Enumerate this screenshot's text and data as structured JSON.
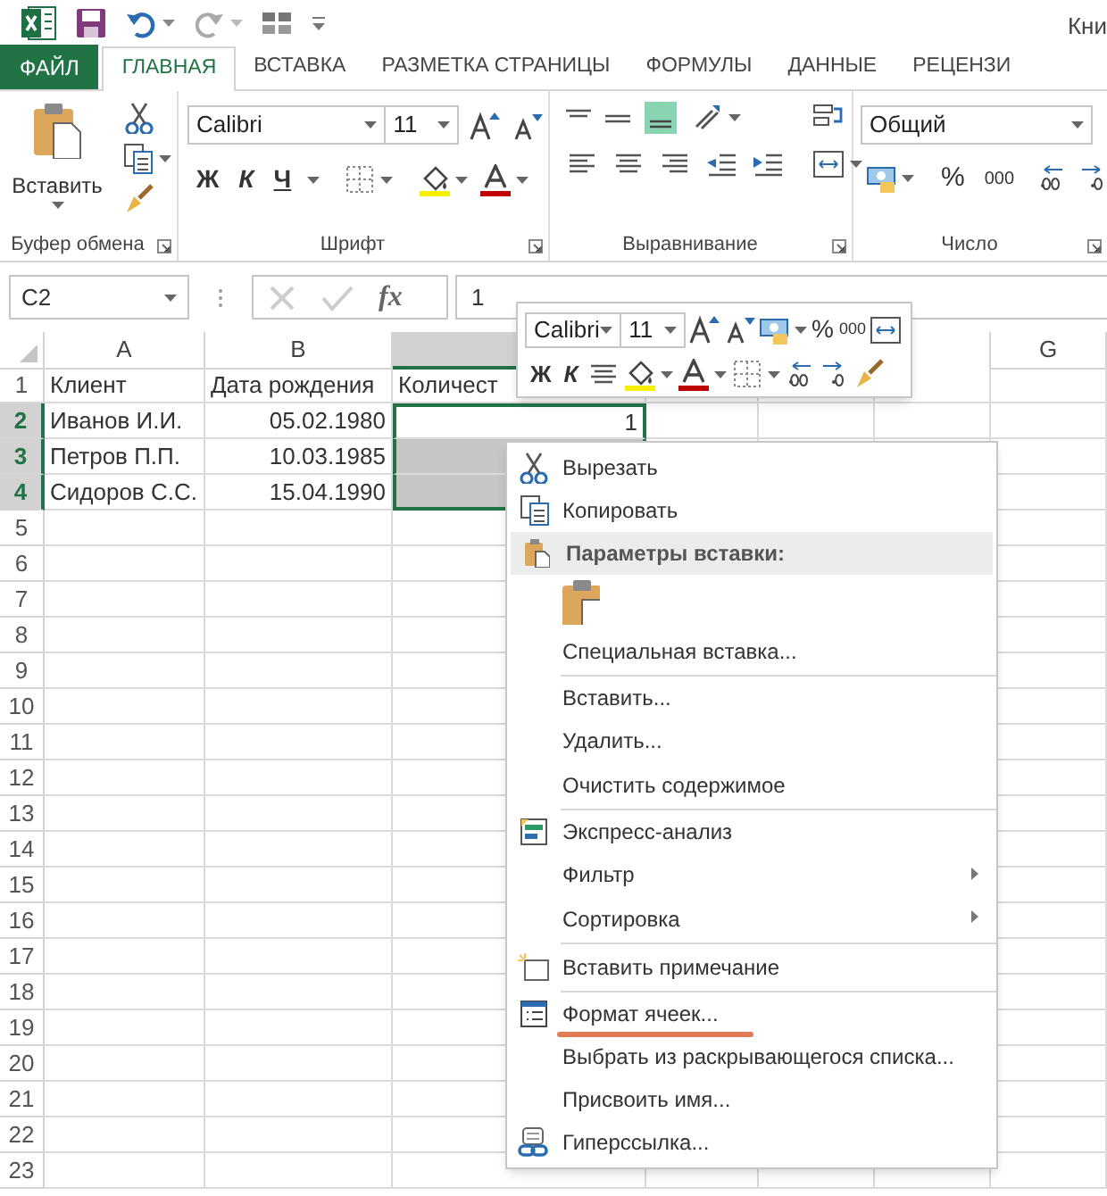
{
  "window": {
    "title": "Кни"
  },
  "tabs": [
    {
      "label": "ФАЙЛ",
      "selected": false,
      "kind": "file"
    },
    {
      "label": "ГЛАВНАЯ",
      "selected": true,
      "kind": "tab"
    },
    {
      "label": "ВСТАВКА",
      "selected": false,
      "kind": "tab"
    },
    {
      "label": "РАЗМЕТКА СТРАНИЦЫ",
      "selected": false,
      "kind": "tab"
    },
    {
      "label": "ФОРМУЛЫ",
      "selected": false,
      "kind": "tab"
    },
    {
      "label": "ДАННЫЕ",
      "selected": false,
      "kind": "tab"
    },
    {
      "label": "РЕЦЕНЗИ",
      "selected": false,
      "kind": "tab"
    }
  ],
  "ribbon": {
    "clipboard": {
      "paste": "Вставить",
      "group": "Буфер обмена"
    },
    "font": {
      "name": "Calibri",
      "size": "11",
      "bold": "Ж",
      "italic": "К",
      "underline": "Ч",
      "group": "Шрифт"
    },
    "alignment": {
      "group": "Выравнивание"
    },
    "number": {
      "format": "Общий",
      "percent": "%",
      "thousands": "000",
      "group": "Число"
    }
  },
  "formula_bar": {
    "name_box": "C2",
    "fx": "fx",
    "value": "1"
  },
  "sheet": {
    "columns": [
      {
        "label": "A",
        "selected": false
      },
      {
        "label": "B",
        "selected": false
      },
      {
        "selected": true
      },
      {
        "label": "G",
        "selected": false
      }
    ],
    "rows": [
      {
        "number": "1",
        "selected": false,
        "cells": [
          {
            "text": "Клиент",
            "kind": "text",
            "selected": false
          },
          {
            "text": "Дата рождения",
            "kind": "text",
            "selected": false
          },
          {
            "text": "Количест",
            "kind": "text",
            "selected": false
          }
        ]
      },
      {
        "number": "2",
        "selected": true,
        "cells": [
          {
            "text": "Иванов И.И.",
            "kind": "text",
            "selected": false
          },
          {
            "text": "05.02.1980",
            "kind": "number",
            "selected": false
          },
          {
            "text": "1",
            "kind": "number",
            "selected": true,
            "active": true
          }
        ]
      },
      {
        "number": "3",
        "selected": true,
        "cells": [
          {
            "text": "Петров П.П.",
            "kind": "text",
            "selected": false
          },
          {
            "text": "10.03.1985",
            "kind": "number",
            "selected": false
          },
          {
            "selected": true,
            "active": false
          }
        ]
      },
      {
        "number": "4",
        "selected": true,
        "cells": [
          {
            "text": "Сидоров С.С.",
            "kind": "text",
            "selected": false
          },
          {
            "text": "15.04.1990",
            "kind": "number",
            "selected": false
          },
          {
            "selected": true,
            "active": false
          }
        ]
      },
      {
        "number": "5",
        "selected": false
      },
      {
        "number": "6",
        "selected": false
      },
      {
        "number": "7",
        "selected": false
      },
      {
        "number": "8",
        "selected": false
      },
      {
        "number": "9",
        "selected": false
      },
      {
        "number": "10",
        "selected": false
      },
      {
        "number": "11",
        "selected": false
      },
      {
        "number": "12",
        "selected": false
      },
      {
        "number": "13",
        "selected": false
      },
      {
        "number": "14",
        "selected": false
      },
      {
        "number": "15",
        "selected": false
      },
      {
        "number": "16",
        "selected": false
      },
      {
        "number": "17",
        "selected": false
      },
      {
        "number": "18",
        "selected": false
      },
      {
        "number": "19",
        "selected": false
      },
      {
        "number": "20",
        "selected": false
      },
      {
        "number": "21",
        "selected": false
      },
      {
        "number": "22",
        "selected": false
      },
      {
        "number": "23",
        "selected": false
      }
    ]
  },
  "mini_toolbar": {
    "font": "Calibri",
    "size": "11",
    "percent": "%",
    "thousands": "000",
    "bold": "Ж",
    "italic": "К"
  },
  "context_menu": [
    {
      "kind": "item",
      "label": "Вырезать",
      "icon": true,
      "submenu": false,
      "separator_after": false,
      "underlined": false
    },
    {
      "kind": "item",
      "label": "Копировать",
      "icon": true,
      "submenu": false,
      "separator_after": false,
      "underlined": false
    },
    {
      "kind": "header",
      "label": "Параметры вставки:",
      "icon": true,
      "submenu": false,
      "separator_after": false,
      "underlined": false
    },
    {
      "kind": "paste_options",
      "icon": true,
      "submenu": false,
      "separator_after": false,
      "underlined": false
    },
    {
      "kind": "item",
      "label": "Специальная вставка...",
      "icon": false,
      "submenu": false,
      "separator_after": true,
      "underlined": false
    },
    {
      "kind": "item",
      "label": "Вставить...",
      "icon": false,
      "submenu": false,
      "separator_after": false,
      "underlined": false
    },
    {
      "kind": "item",
      "label": "Удалить...",
      "icon": false,
      "submenu": false,
      "separator_after": false,
      "underlined": false
    },
    {
      "kind": "item",
      "label": "Очистить содержимое",
      "icon": false,
      "submenu": false,
      "separator_after": true,
      "underlined": false
    },
    {
      "kind": "item",
      "label": "Экспресс-анализ",
      "icon": true,
      "submenu": false,
      "separator_after": false,
      "underlined": false
    },
    {
      "kind": "item",
      "label": "Фильтр",
      "icon": false,
      "submenu": true,
      "separator_after": false,
      "underlined": false
    },
    {
      "kind": "item",
      "label": "Сортировка",
      "icon": false,
      "submenu": true,
      "separator_after": true,
      "underlined": false
    },
    {
      "kind": "item",
      "label": "Вставить примечание",
      "icon": true,
      "submenu": false,
      "separator_after": true,
      "underlined": false
    },
    {
      "kind": "item",
      "label": "Формат ячеек...",
      "icon": true,
      "submenu": false,
      "separator_after": false,
      "underlined": true
    },
    {
      "kind": "item",
      "label": "Выбрать из раскрывающегося списка...",
      "icon": false,
      "submenu": false,
      "separator_after": false,
      "underlined": false
    },
    {
      "kind": "item",
      "label": "Присвоить имя...",
      "icon": false,
      "submenu": false,
      "separator_after": false,
      "underlined": false
    },
    {
      "kind": "item",
      "label": "Гиперссылка...",
      "icon": true,
      "submenu": false,
      "separator_after": false,
      "underlined": false
    }
  ]
}
